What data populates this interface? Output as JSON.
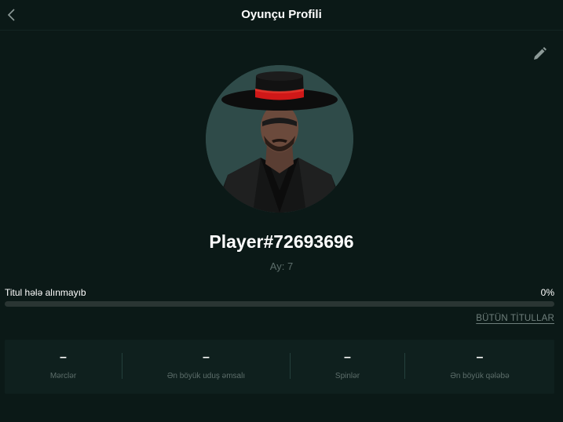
{
  "header": {
    "title": "Oyunçu Profili",
    "back_icon": "chevron-left-icon"
  },
  "profile": {
    "edit_icon": "pencil-icon",
    "avatar": "avatar-man-black-hat-red-band",
    "name": "Player#72693696",
    "month_label": "Ay: 7"
  },
  "titles": {
    "status": "Titul hələ alınmayıb",
    "progress_percent": "0%",
    "progress_fraction": 0,
    "all_titles_label": "BÜTÜN TİTULLAR"
  },
  "stats": [
    {
      "value": "–",
      "label": "Mərclər"
    },
    {
      "value": "–",
      "label": "Ən böyük uduş əmsalı"
    },
    {
      "value": "–",
      "label": "Spinlər"
    },
    {
      "value": "–",
      "label": "Ən böyük qələbə"
    }
  ],
  "colors": {
    "background": "#0b1917",
    "panel": "#0f201e",
    "progress_track": "#2a3533",
    "muted_text": "#5d6e6b",
    "hat_band": "#d01818"
  }
}
